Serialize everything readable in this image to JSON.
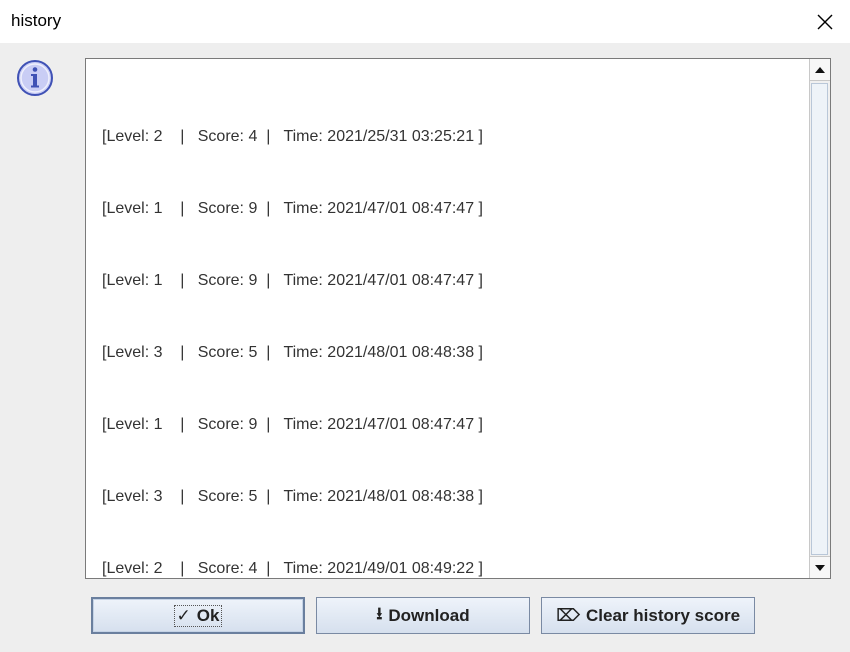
{
  "window": {
    "title": "history"
  },
  "icons": {
    "close": "close-icon",
    "info": "info-icon"
  },
  "history": {
    "lines": [
      "[Level: 2    |   Score: 4  |   Time: 2021/25/31 03:25:21 ]",
      "[Level: 1    |   Score: 9  |   Time: 2021/47/01 08:47:47 ]",
      "[Level: 1    |   Score: 9  |   Time: 2021/47/01 08:47:47 ]",
      "[Level: 3    |   Score: 5  |   Time: 2021/48/01 08:48:38 ]",
      "[Level: 1    |   Score: 9  |   Time: 2021/47/01 08:47:47 ]",
      "[Level: 3    |   Score: 5  |   Time: 2021/48/01 08:48:38 ]",
      "[Level: 2    |   Score: 4  |   Time: 2021/49/01 08:49:22 ]"
    ]
  },
  "buttons": {
    "ok": {
      "glyph": "✓",
      "label": "Ok"
    },
    "download": {
      "glyph": "⭳",
      "label": "Download"
    },
    "clear": {
      "glyph": "⌦",
      "label": "Clear history score"
    }
  },
  "colors": {
    "accent": "#3f51b5",
    "info_fill": "#c9cdf5"
  }
}
